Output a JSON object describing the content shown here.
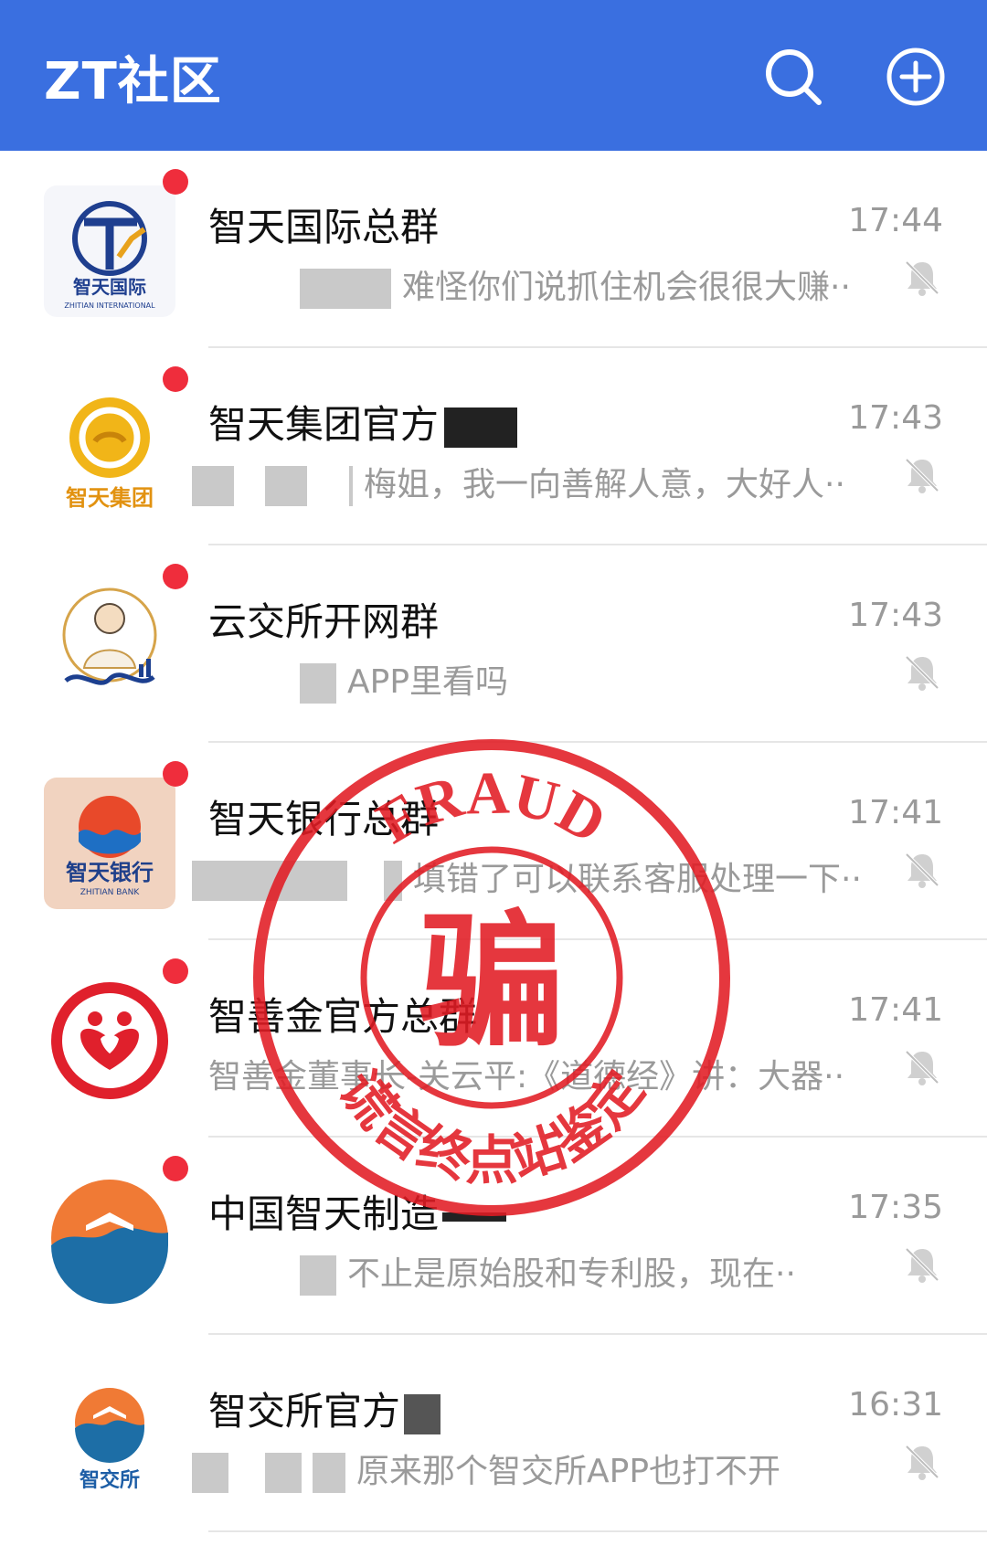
{
  "header": {
    "title": "ZT社区",
    "search_icon": "search-icon",
    "add_icon": "add-circle-icon"
  },
  "colors": {
    "header_bg": "#3a6fe0",
    "unread_dot": "#ef2d3c",
    "stamp": "#e21c24"
  },
  "chats": [
    {
      "name": "智天国际总群",
      "time": "17:44",
      "preview": "难怪你们说抓住机会很很大赚··",
      "avatar_text": "智天国际",
      "avatar_sub": "ZHITIAN INTERNATIONAL"
    },
    {
      "name": "智天集团官方",
      "time": "17:43",
      "preview": "梅姐，我一向善解人意，大好人··",
      "avatar_text": "智天集团"
    },
    {
      "name": "云交所开网群",
      "time": "17:43",
      "preview": "APP里看吗"
    },
    {
      "name": "智天银行总群",
      "time": "17:41",
      "preview": "填错了可以联系客服处理一下··",
      "avatar_text": "智天银行",
      "avatar_sub": "ZHITIAN BANK"
    },
    {
      "name": "智善金官方总群",
      "time": "17:41",
      "preview": "智善金董事长-关云平:《道德经》讲：大器··"
    },
    {
      "name": "中国智天制造",
      "time": "17:35",
      "preview": "不止是原始股和专利股，现在··"
    },
    {
      "name": "智交所官方",
      "time": "16:31",
      "preview": "原来那个智交所APP也打不开",
      "avatar_text": "智交所"
    }
  ],
  "stamp": {
    "top_text": "FRAUD",
    "center_text": "骗",
    "bottom_text": "谎言终点站鉴定"
  }
}
